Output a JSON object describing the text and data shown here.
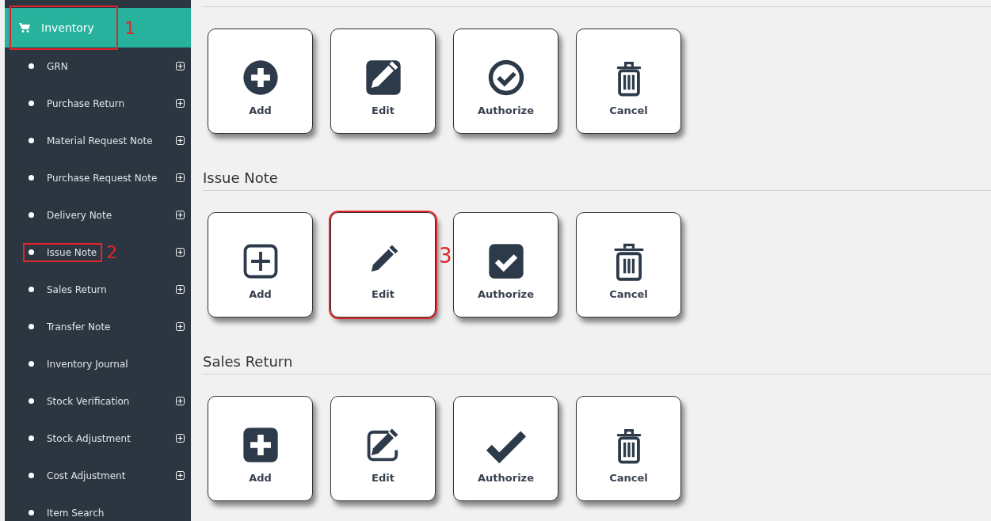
{
  "sidebar": {
    "header": {
      "label": "Inventory",
      "callout": "1"
    },
    "items": [
      {
        "label": "GRN",
        "expandable": true
      },
      {
        "label": "Purchase Return",
        "expandable": true
      },
      {
        "label": "Material Request Note",
        "expandable": true
      },
      {
        "label": "Purchase Request Note",
        "expandable": true
      },
      {
        "label": "Delivery Note",
        "expandable": true
      },
      {
        "label": "Issue Note",
        "expandable": true,
        "callout": "2"
      },
      {
        "label": "Sales Return",
        "expandable": true
      },
      {
        "label": "Transfer Note",
        "expandable": true
      },
      {
        "label": "Inventory Journal",
        "expandable": false
      },
      {
        "label": "Stock Verification",
        "expandable": true
      },
      {
        "label": "Stock Adjustment",
        "expandable": true
      },
      {
        "label": "Cost Adjustment",
        "expandable": true
      },
      {
        "label": "Item Search",
        "expandable": false
      }
    ]
  },
  "sections": [
    {
      "buttons": [
        {
          "label": "Add"
        },
        {
          "label": "Edit"
        },
        {
          "label": "Authorize"
        },
        {
          "label": "Cancel"
        }
      ]
    },
    {
      "title": "Issue Note",
      "buttons": [
        {
          "label": "Add"
        },
        {
          "label": "Edit",
          "callout": "3"
        },
        {
          "label": "Authorize"
        },
        {
          "label": "Cancel"
        }
      ]
    },
    {
      "title": "Sales Return",
      "buttons": [
        {
          "label": "Add"
        },
        {
          "label": "Edit"
        },
        {
          "label": "Authorize"
        },
        {
          "label": "Cancel"
        }
      ]
    }
  ]
}
